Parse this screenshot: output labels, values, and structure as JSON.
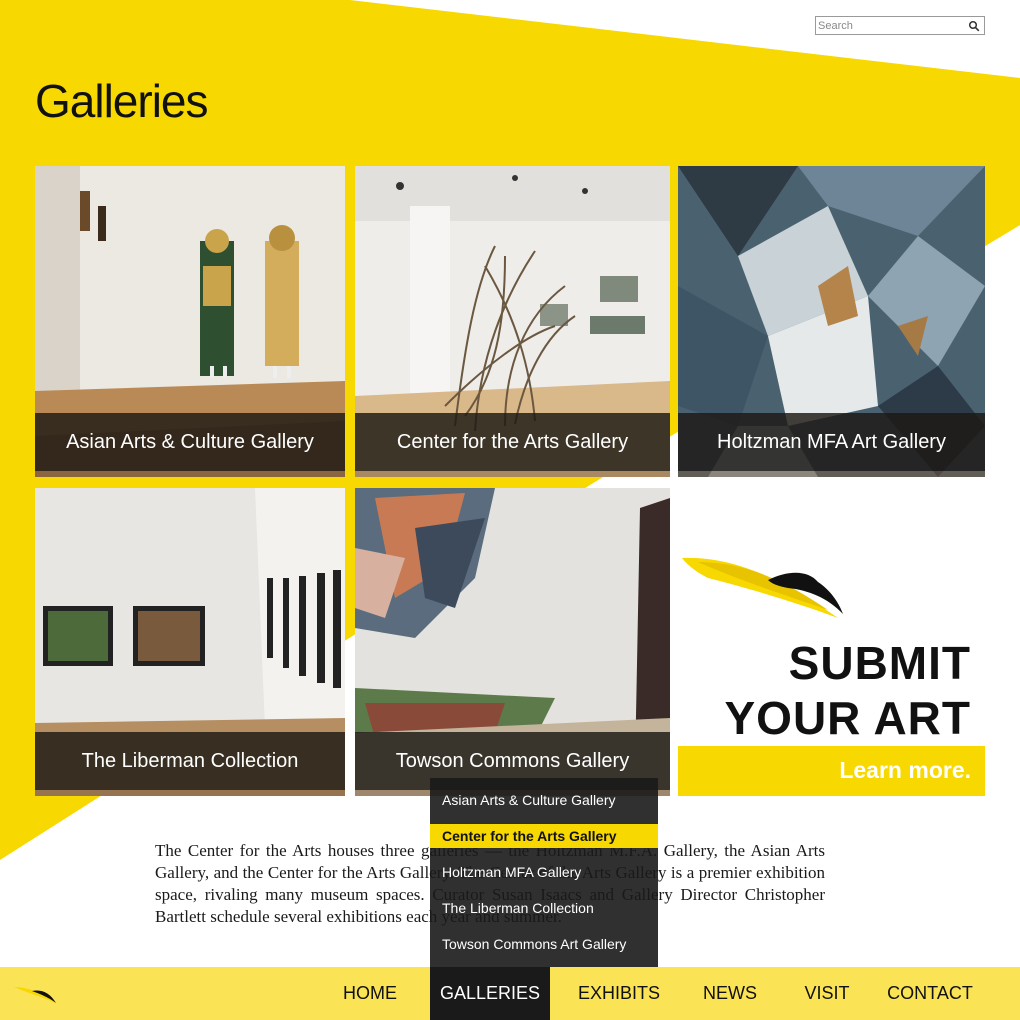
{
  "search": {
    "placeholder": "Search"
  },
  "page_title": "Galleries",
  "galleries": [
    {
      "label": "Asian Arts & Culture Gallery"
    },
    {
      "label": "Center for the Arts Gallery"
    },
    {
      "label": "Holtzman MFA Art Gallery"
    },
    {
      "label": "The Liberman Collection"
    },
    {
      "label": "Towson Commons Gallery"
    }
  ],
  "submit": {
    "line1": "SUBMIT",
    "line2": "YOUR ART",
    "cta": "Learn more."
  },
  "intro_text": "The Center for the Arts houses three galleries — the Holtzman M.F.A. Gallery, the Asian Arts Gallery, and the Center for the Arts Gallery. The Center of the Arts Gallery is a premier exhibition space, rivaling many museum spaces. Curator Susan Isaacs and Gallery Director Christopher Bartlett schedule several exhibitions each year and summer.",
  "nav": [
    {
      "label": "HOME"
    },
    {
      "label": "GALLERIES",
      "active": true
    },
    {
      "label": "EXHIBITS"
    },
    {
      "label": "NEWS"
    },
    {
      "label": "VISIT"
    },
    {
      "label": "CONTACT"
    }
  ],
  "dropdown": [
    {
      "label": "Asian Arts & Culture Gallery"
    },
    {
      "label": "Center for the Arts Gallery",
      "active": true
    },
    {
      "label": "Holtzman MFA Gallery"
    },
    {
      "label": "The Liberman Collection"
    },
    {
      "label": "Towson Commons Art Gallery"
    }
  ],
  "colors": {
    "brand_yellow": "#f7d800",
    "footer_yellow": "#fbe356",
    "dark": "#1a1a1a"
  }
}
